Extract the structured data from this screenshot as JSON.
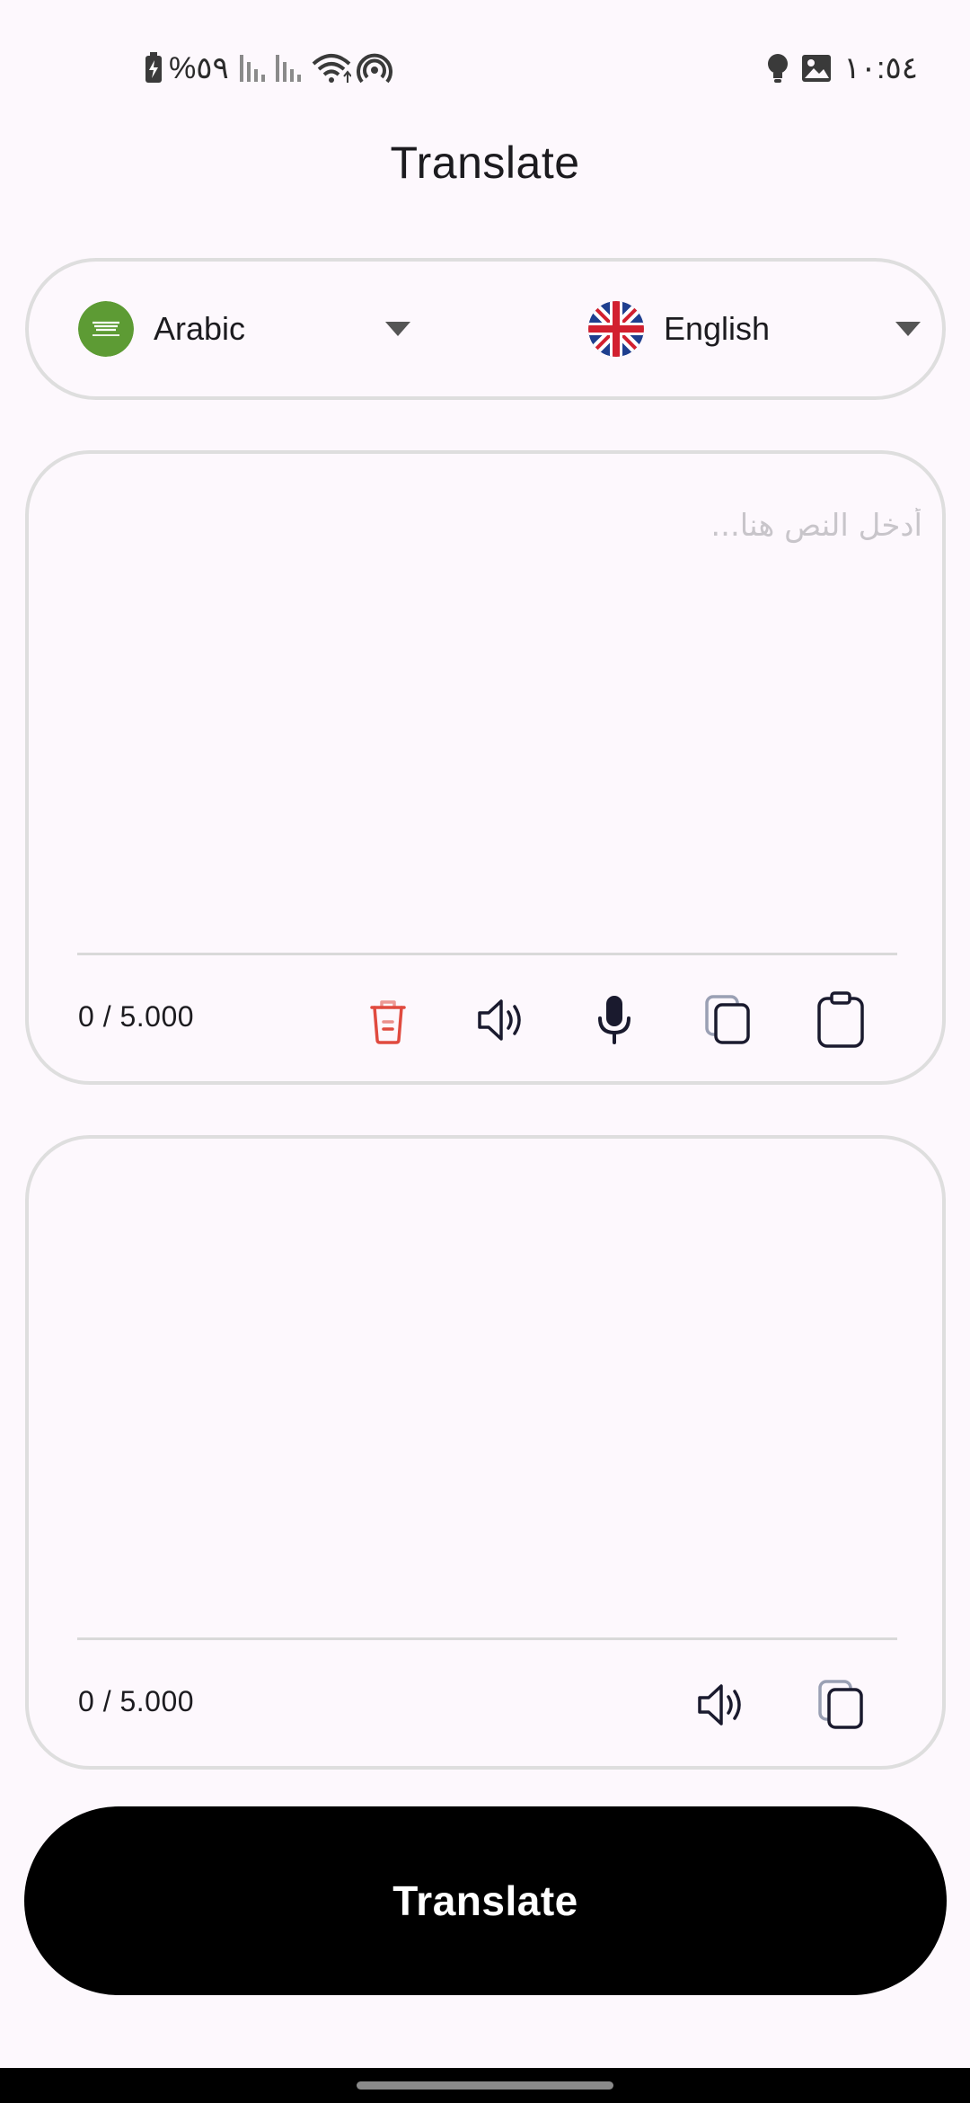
{
  "status_bar": {
    "time": "١٠:٥٤",
    "battery": "%٥٩",
    "icons": [
      "charging-battery-icon",
      "signal-icon",
      "signal-icon",
      "wifi-icon",
      "hotspot-icon",
      "bulb-icon",
      "gallery-icon"
    ]
  },
  "header": {
    "title": "Translate"
  },
  "languages": {
    "source": {
      "label": "Arabic",
      "flag": "saudi-flag-icon"
    },
    "target": {
      "label": "English",
      "flag": "uk-flag-icon"
    }
  },
  "source_panel": {
    "placeholder": "أدخل النص هنا...",
    "value": "",
    "counter": "0 / 5.000",
    "tools": [
      "trash-icon",
      "speaker-icon",
      "microphone-icon",
      "copy-icon",
      "paste-icon"
    ]
  },
  "target_panel": {
    "value": "",
    "counter": "0 / 5.000",
    "tools": [
      "speaker-icon",
      "copy-icon"
    ]
  },
  "actions": {
    "translate_label": "Translate"
  },
  "colors": {
    "background": "#fdf8fd",
    "border": "#dedede",
    "primary_button": "#000000",
    "delete": "#e04a3f",
    "icon": "#1a1a2e"
  }
}
